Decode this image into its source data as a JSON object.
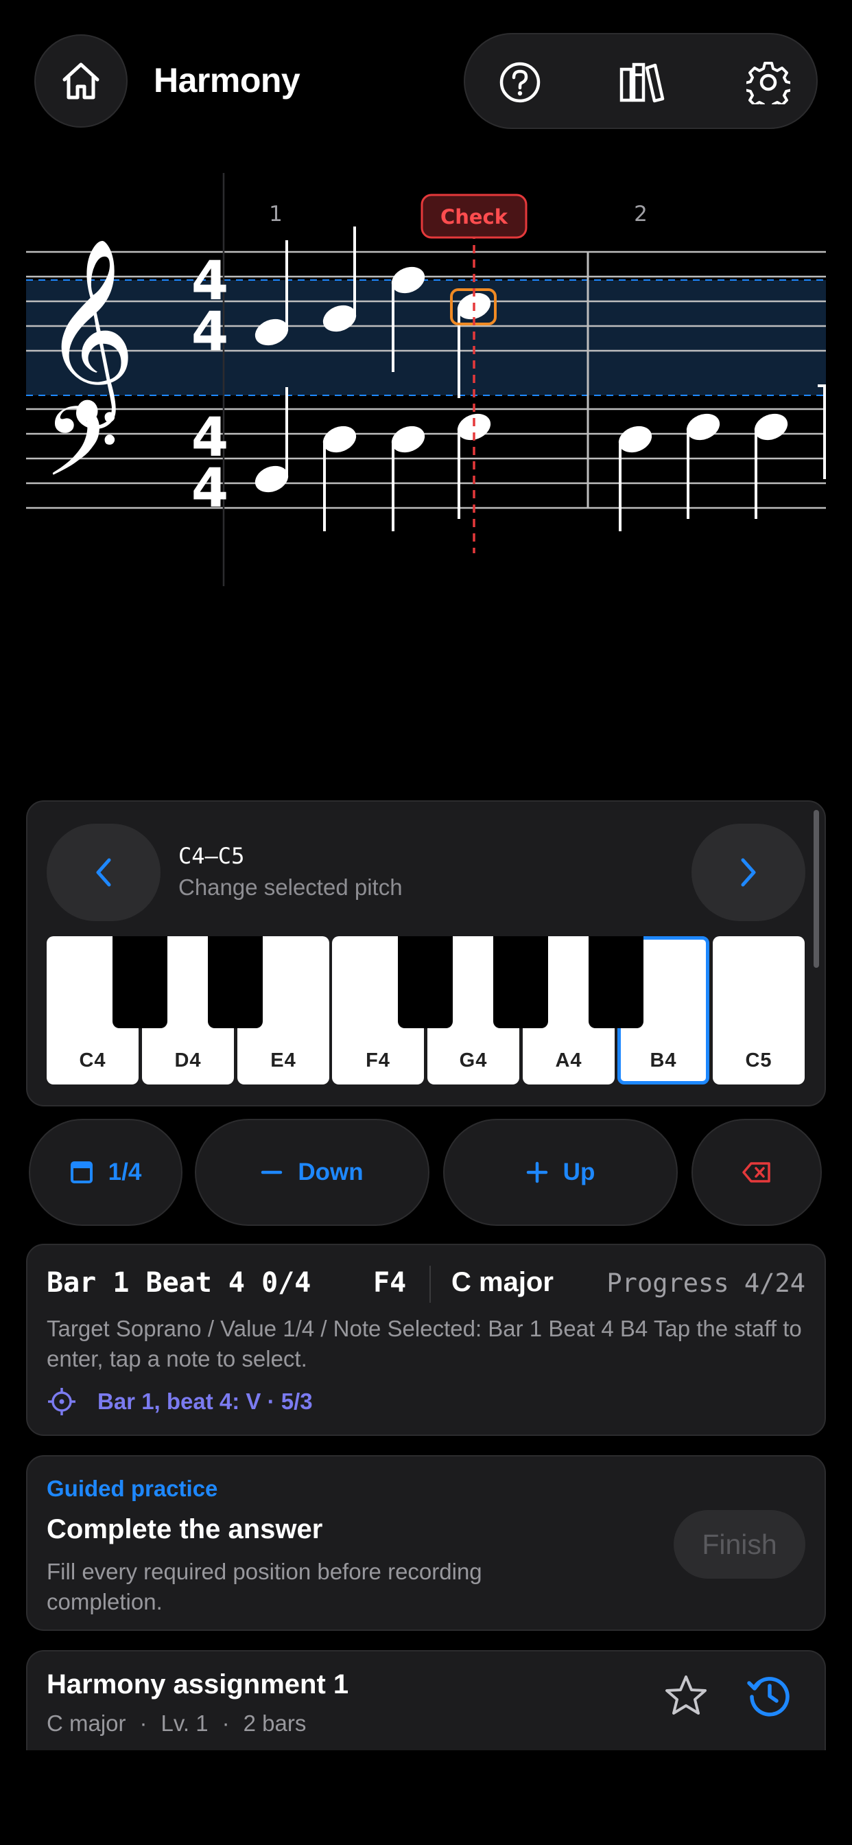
{
  "header": {
    "title": "Harmony",
    "icons": [
      "home-icon",
      "help-icon",
      "library-icon",
      "gear-icon"
    ]
  },
  "score": {
    "measure_numbers": [
      "1",
      "2"
    ],
    "check_label": "Check",
    "time_signature": {
      "top": "4",
      "bottom": "4"
    },
    "clefs": [
      "treble-clef",
      "bass-clef"
    ]
  },
  "pitch_panel": {
    "range_title": "C4–C5",
    "range_subtitle": "Change selected pitch",
    "keys": [
      "C4",
      "D4",
      "E4",
      "F4",
      "G4",
      "A4",
      "B4",
      "C5"
    ],
    "selected_key": "B4"
  },
  "actions": {
    "duration_label": "1/4",
    "down_label": "Down",
    "up_label": "Up"
  },
  "status": {
    "position": "Bar 1 Beat 4 0/4",
    "note": "F4",
    "key": "C major",
    "progress": "Progress 4/24",
    "detail": "Target Soprano / Value 1/4 / Note  Selected: Bar 1 Beat 4 B4  Tap the staff to enter, tap a note to select.",
    "hint": "Bar 1, beat 4: V · 5/3"
  },
  "guided": {
    "label": "Guided practice",
    "title": "Complete the answer",
    "description": "Fill every required position before recording completion.",
    "finish_label": "Finish"
  },
  "assignment": {
    "title": "Harmony assignment 1",
    "key": "C major",
    "sep": "·",
    "level": "Lv. 1",
    "bars": "2 bars"
  },
  "colors": {
    "accent": "#1e88ff",
    "danger": "#e5393b",
    "hint": "#7b7bf0",
    "selection": "#0e2238",
    "highlight": "#f08a24"
  }
}
